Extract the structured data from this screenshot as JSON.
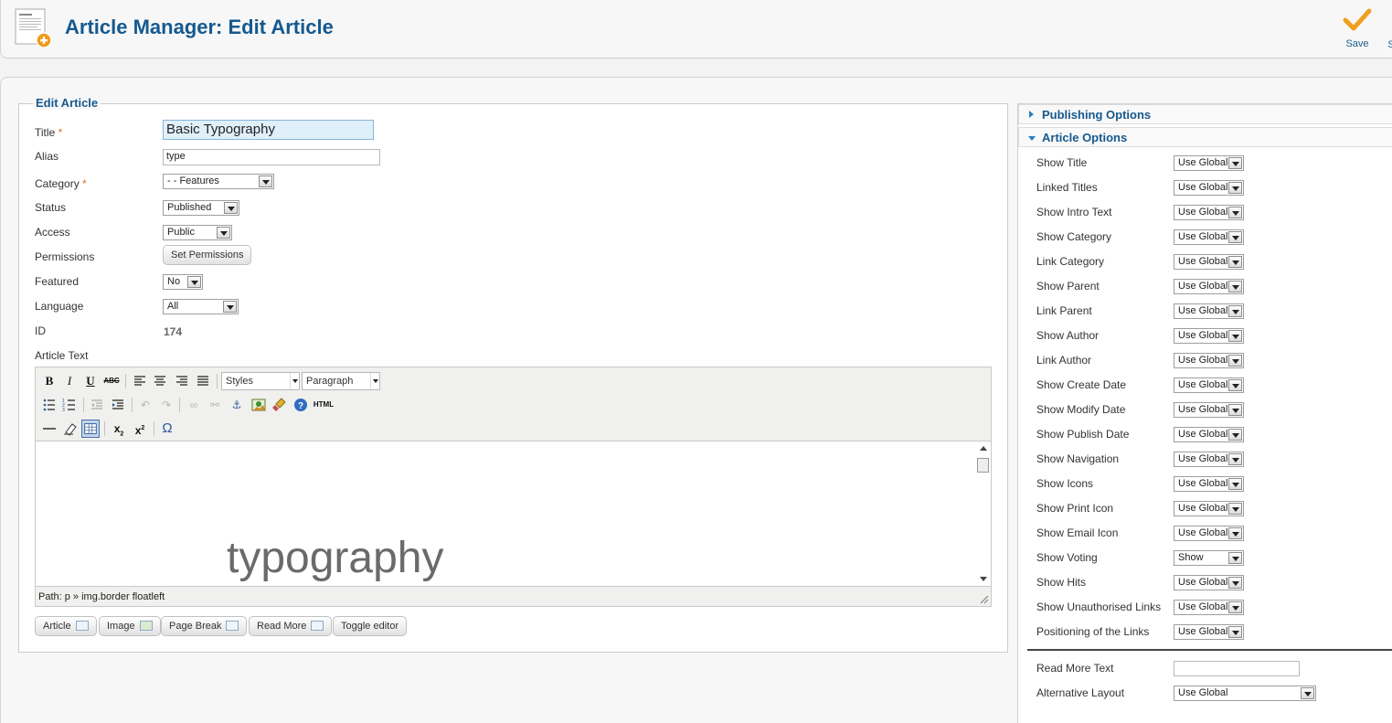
{
  "header": {
    "title": "Article Manager: Edit Article"
  },
  "toolbar": {
    "save_label": "Save",
    "next_label": "S"
  },
  "form": {
    "legend": "Edit Article",
    "title_label": "Title",
    "required_mark": "*",
    "title_value": "Basic Typography",
    "alias_label": "Alias",
    "alias_value": "type",
    "category_label": "Category",
    "category_value": "- - Features",
    "status_label": "Status",
    "status_value": "Published",
    "access_label": "Access",
    "access_value": "Public",
    "permissions_label": "Permissions",
    "permissions_button": "Set Permissions",
    "featured_label": "Featured",
    "featured_value": "No",
    "language_label": "Language",
    "language_value": "All",
    "id_label": "ID",
    "id_value": "174",
    "article_text_label": "Article Text"
  },
  "editor": {
    "styles_select": "Styles",
    "format_select": "Paragraph",
    "html_button": "HTML",
    "content_text": "typography",
    "path_text": "Path: p » img.border floatleft",
    "buttons": {
      "article": "Article",
      "image": "Image",
      "page_break": "Page Break",
      "read_more": "Read More",
      "toggle": "Toggle editor"
    }
  },
  "right_panel": {
    "publishing_header": "Publishing Options",
    "article_options_header": "Article Options",
    "options": [
      {
        "label": "Show Title",
        "value": "Use Global"
      },
      {
        "label": "Linked Titles",
        "value": "Use Global"
      },
      {
        "label": "Show Intro Text",
        "value": "Use Global"
      },
      {
        "label": "Show Category",
        "value": "Use Global"
      },
      {
        "label": "Link Category",
        "value": "Use Global"
      },
      {
        "label": "Show Parent",
        "value": "Use Global"
      },
      {
        "label": "Link Parent",
        "value": "Use Global"
      },
      {
        "label": "Show Author",
        "value": "Use Global"
      },
      {
        "label": "Link Author",
        "value": "Use Global"
      },
      {
        "label": "Show Create Date",
        "value": "Use Global"
      },
      {
        "label": "Show Modify Date",
        "value": "Use Global"
      },
      {
        "label": "Show Publish Date",
        "value": "Use Global"
      },
      {
        "label": "Show Navigation",
        "value": "Use Global"
      },
      {
        "label": "Show Icons",
        "value": "Use Global"
      },
      {
        "label": "Show Print Icon",
        "value": "Use Global"
      },
      {
        "label": "Show Email Icon",
        "value": "Use Global"
      },
      {
        "label": "Show Voting",
        "value": "Show"
      },
      {
        "label": "Show Hits",
        "value": "Use Global"
      },
      {
        "label": "Show Unauthorised Links",
        "value": "Use Global"
      },
      {
        "label": "Positioning of the Links",
        "value": "Use Global"
      }
    ],
    "read_more_label": "Read More Text",
    "read_more_value": "",
    "alt_layout_label": "Alternative Layout",
    "alt_layout_value": "Use Global"
  },
  "colors": {
    "accent": "#15598f",
    "required": "#e06f1b",
    "save_check": "#f0a020"
  }
}
